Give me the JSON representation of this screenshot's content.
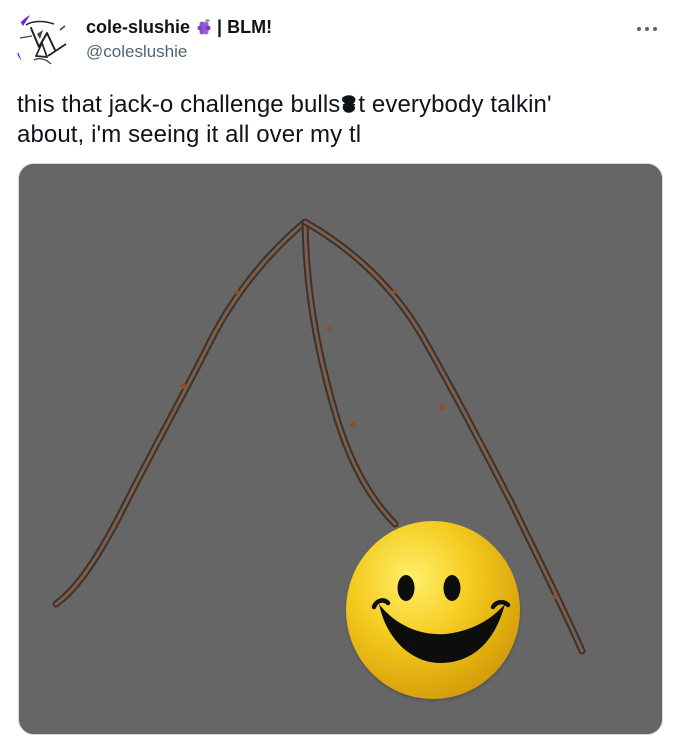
{
  "tweet": {
    "author": {
      "display_name": "cole-slushie",
      "name_emoji": "grapes-emoji",
      "name_suffix": " | BLM!",
      "handle": "@coleslushie"
    },
    "more_menu_icon": "more-horizontal-icon",
    "text_lines": [
      {
        "before": "this that jack-o challenge bulls",
        "redacted": "scribble-redaction",
        "after": "t everybody talkin'"
      },
      {
        "text": "about, i'm seeing it all over my tl"
      }
    ],
    "media": {
      "background": "#666666",
      "objects": [
        "three-twig-legs",
        "smiley-face-ball"
      ]
    }
  },
  "colors": {
    "text_primary": "#0f1419",
    "text_secondary": "#536471",
    "border": "#cfd9de",
    "smiley_yellow": "#f2c51c",
    "twig_brown": "#5b4636"
  }
}
